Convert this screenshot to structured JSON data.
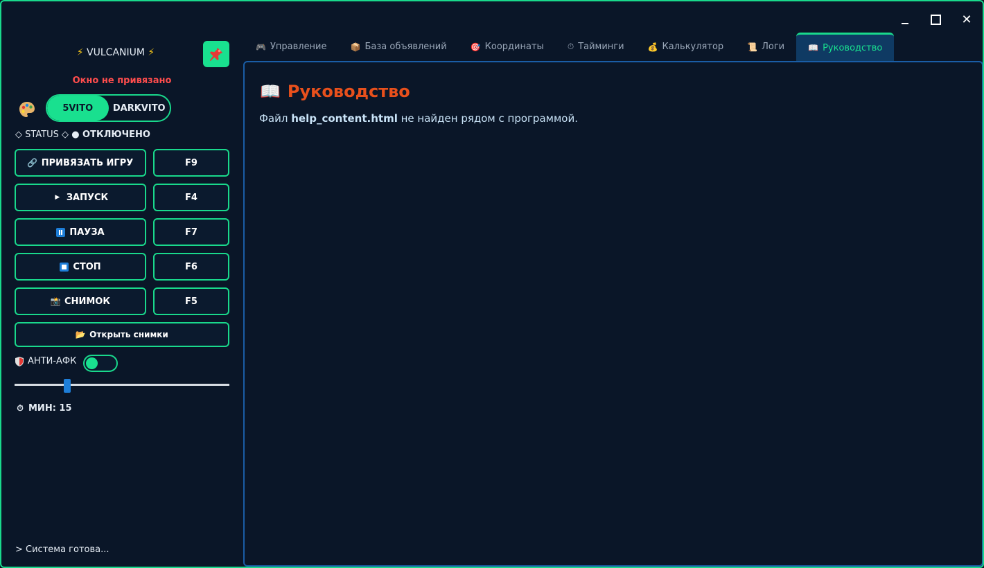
{
  "window": {
    "controls": [
      "minimize-icon",
      "maximize-icon",
      "close-icon"
    ]
  },
  "sidebar": {
    "brand": "VULCANIUM",
    "warning": "Окно не привязано",
    "modes": [
      {
        "label": "5VITO",
        "active": true
      },
      {
        "label": "DARKVITO",
        "active": false
      }
    ],
    "status_label": "◇ STATUS ◇",
    "status_value": "● ОТКЛЮЧЕНО",
    "buttons": [
      {
        "label": "ПРИВЯЗАТЬ ИГРУ",
        "key": "F9",
        "icon": "link-icon"
      },
      {
        "label": "ЗАПУСК",
        "key": "F4",
        "icon": "play-icon"
      },
      {
        "label": "ПАУЗА",
        "key": "F7",
        "icon": "pause-icon"
      },
      {
        "label": "СТОП",
        "key": "F6",
        "icon": "stop-icon"
      },
      {
        "label": "СНИМОК",
        "key": "F5",
        "icon": "camera-icon"
      }
    ],
    "open_snapshots": "Открыть снимки",
    "anti_afk_label": "АНТИ-АФК",
    "anti_afk_on": true,
    "slider_value": 15,
    "min_label": "МИН: 15",
    "console": "> Система готова..."
  },
  "tabs": [
    {
      "label": "Управление",
      "icon": "gamepad-icon",
      "active": false
    },
    {
      "label": "База объявлений",
      "icon": "box-icon",
      "active": false
    },
    {
      "label": "Координаты",
      "icon": "target-icon",
      "active": false
    },
    {
      "label": "Тайминги",
      "icon": "stopwatch-icon",
      "active": false
    },
    {
      "label": "Калькулятор",
      "icon": "money-bag-icon",
      "active": false
    },
    {
      "label": "Логи",
      "icon": "scroll-icon",
      "active": false
    },
    {
      "label": "Руководство",
      "icon": "book-icon",
      "active": true
    }
  ],
  "content": {
    "title": "Руководство",
    "text_prefix": "Файл ",
    "filename": "help_content.html",
    "text_suffix": " не найден рядом с программой."
  },
  "colors": {
    "accent": "#19e08f",
    "background": "#0a1628",
    "warning": "#ff4d4d",
    "title": "#e8501c",
    "tab_active_bg": "#0f3a63"
  }
}
